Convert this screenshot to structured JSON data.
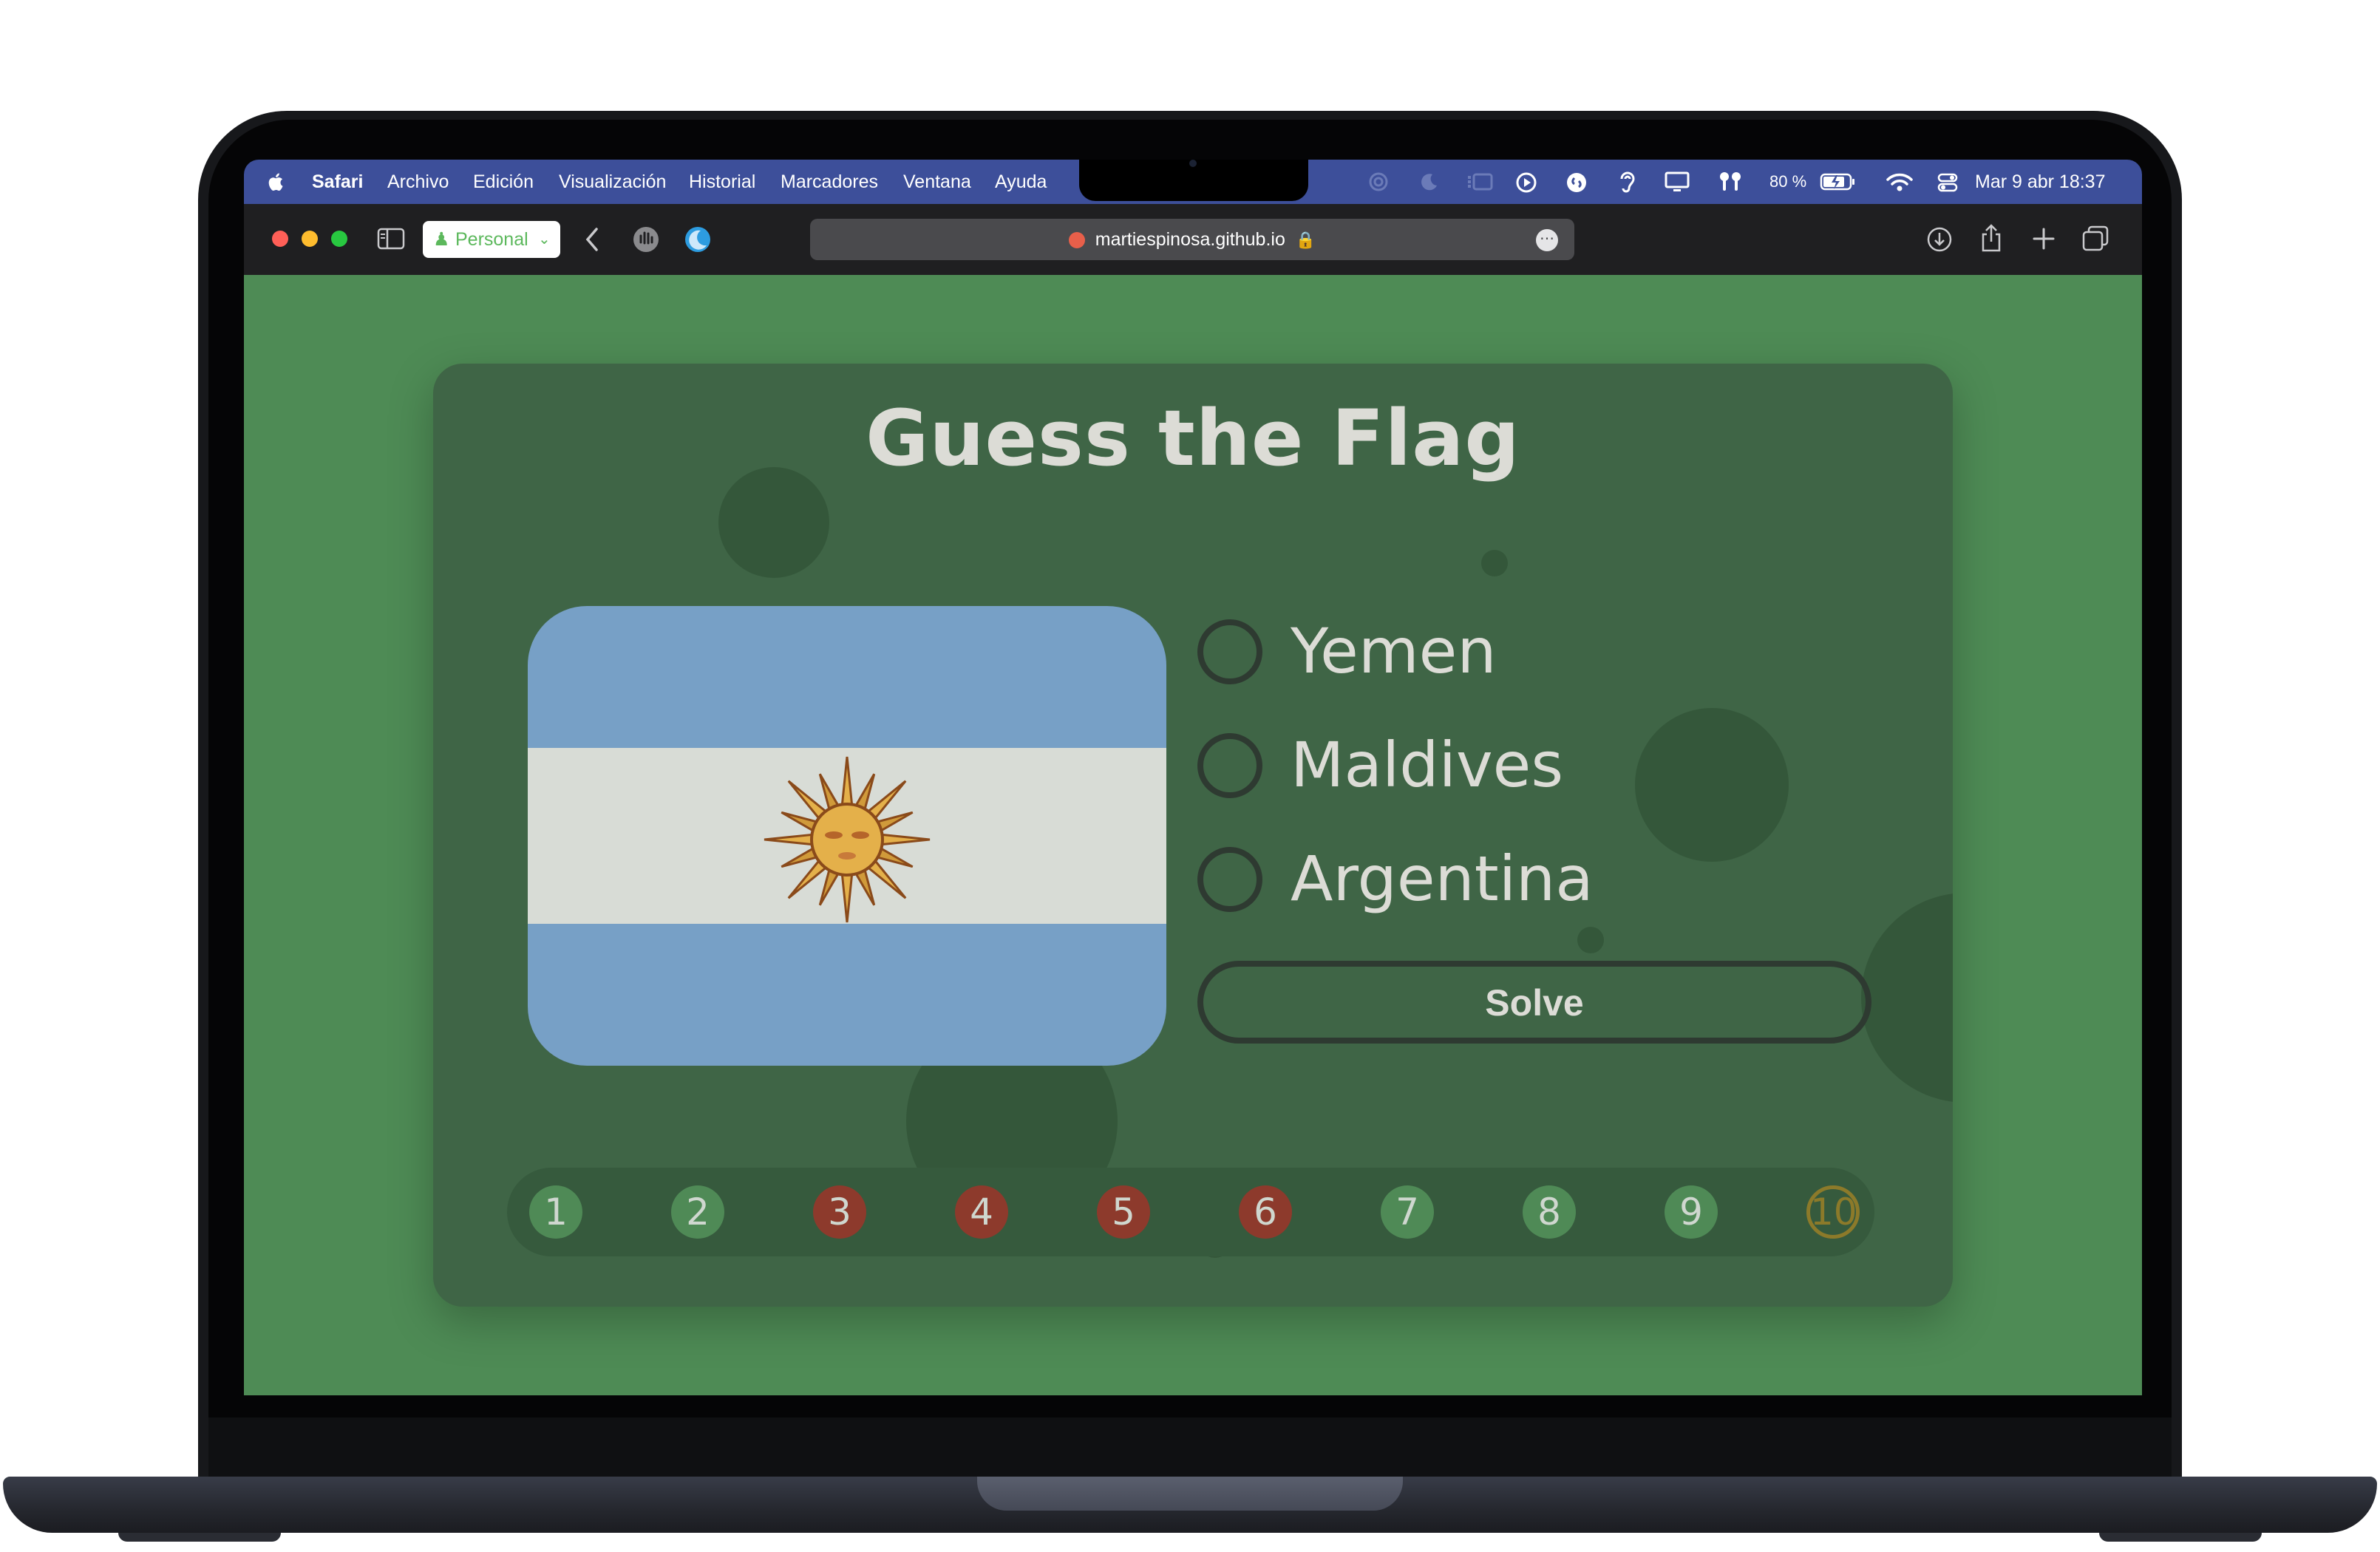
{
  "menubar": {
    "apple_icon": "apple-icon",
    "app_name": "Safari",
    "menus": [
      "Archivo",
      "Edición",
      "Visualización",
      "Historial",
      "Marcadores",
      "Ventana",
      "Ayuda"
    ],
    "battery": "80 %",
    "datetime": "Mar 9 abr 18:37"
  },
  "toolbar": {
    "profile_label": "Personal",
    "url": "martiespinosa.github.io"
  },
  "game": {
    "title": "Guess the Flag",
    "flag_icon": "argentina-flag",
    "options": [
      "Yemen",
      "Maldives",
      "Argentina"
    ],
    "solve_label": "Solve",
    "progress": [
      {
        "label": "1",
        "status": "correct"
      },
      {
        "label": "2",
        "status": "correct"
      },
      {
        "label": "3",
        "status": "wrong"
      },
      {
        "label": "4",
        "status": "wrong"
      },
      {
        "label": "5",
        "status": "wrong"
      },
      {
        "label": "6",
        "status": "wrong"
      },
      {
        "label": "7",
        "status": "correct"
      },
      {
        "label": "8",
        "status": "correct"
      },
      {
        "label": "9",
        "status": "correct"
      },
      {
        "label": "10",
        "status": "current"
      }
    ]
  },
  "colors": {
    "page_bg": "#4e8b55",
    "card_bg": "#3f6546",
    "correct": "#4f8a56",
    "wrong": "#8d3a2c",
    "current_ring": "#8c7a2a",
    "flag_blue": "#77a0c6",
    "flag_white": "#d8dcd6",
    "sun": "#e4b04a"
  }
}
